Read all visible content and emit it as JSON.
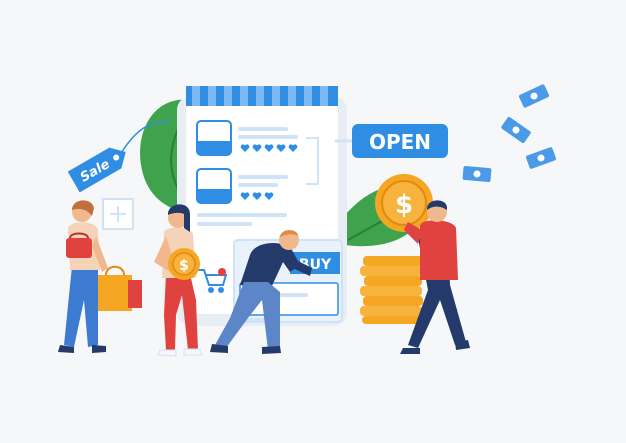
{
  "labels": {
    "sale": "Sale",
    "open": "OPEN",
    "buy": "BUY"
  },
  "icons": {
    "plus": "plus-icon",
    "cart": "cart-icon",
    "coin": "dollar-coin-icon",
    "bill": "dollar-bill-icon",
    "heart": "heart-icon"
  },
  "colors": {
    "background": "#f6f7f9",
    "blue_primary": "#2f8de4",
    "blue_light": "#cfe3f7",
    "coin_gold": "#f5a623",
    "coin_dark": "#e08a10",
    "leaf_green": "#3fa34d",
    "navy": "#243a6a",
    "red_shirt": "#e0433f"
  },
  "rating": {
    "item_1_hearts": 5,
    "item_2_hearts": 3
  }
}
